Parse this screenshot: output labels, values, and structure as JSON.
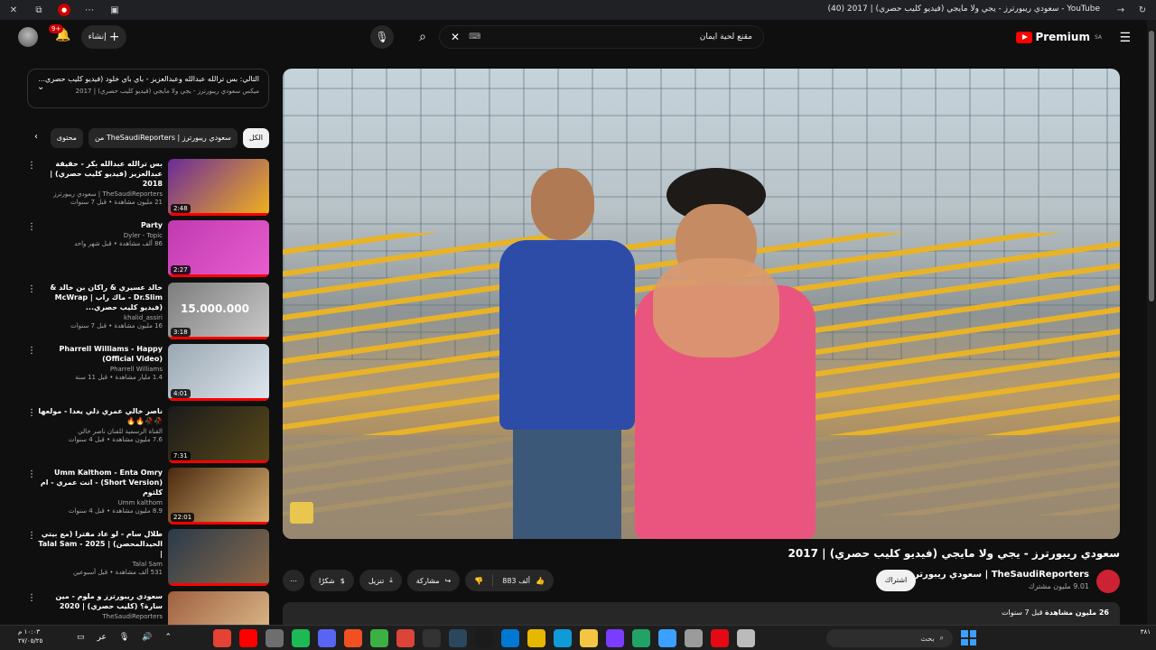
{
  "browser": {
    "title": "YouTube - سعودي ريبورترز - يجي ولا مايجي (فيديو كليب حصري) | 2017 (40)",
    "icons": [
      "close-icon",
      "extension-icon",
      "badge-icon",
      "more-icon",
      "screenshot-icon"
    ]
  },
  "header": {
    "create_label": "إنشاء",
    "notifications_badge": "9+",
    "search_value": "مقنع لحية ايمان",
    "keyboard_label": "⌨",
    "logo_text": "Premium",
    "region": "SA"
  },
  "queue_header": {
    "next_label": "التالي: بس ترالله عبدالله وعبدالعزيز - باي باي خلود (فيديو كليب حصري...",
    "mix_label": "ميكس سعودي ريبورترز - يجي ولا مايجي (فيديو كليب حصري) | 2017"
  },
  "chips": [
    {
      "label": "الكل",
      "active": true
    },
    {
      "label": "من TheSaudiReporters | سعودي ريبورترز",
      "active": false
    },
    {
      "label": "محتوى",
      "active": false
    }
  ],
  "queue": [
    {
      "title": "بس ترالله عبدالله بكر - حقيقة عبدالعزيز (فيديو كليب حصري) | 2018",
      "channel": "TheSaudiReporters | سعودي ريبورترز",
      "stats": "21 مليون مشاهدة • قبل 7 سنوات",
      "duration": "2:48",
      "thumb": "#6b2a9a",
      "thumb2": "#f2b21c"
    },
    {
      "title": "Party",
      "channel": "Dyler - Topic",
      "stats": "86 ألف مشاهدة • قبل شهر واحد",
      "duration": "2:27",
      "thumb": "#c03ab0",
      "thumb2": "#e85ed0"
    },
    {
      "title": "خالد عسيري & راكان بن خالد & Dr.Slim - ماك راب | McWrap (فيديو كليب حصري...",
      "channel": "khalid_assiri",
      "stats": "16 مليون مشاهدة • قبل 7 سنوات",
      "duration": "3:18",
      "thumb": "#7d7d7d",
      "thumb2": "#c9c9c9",
      "overlay": "15.000.000"
    },
    {
      "title": "Pharrell Williams - Happy (Official Video)",
      "channel": "Pharrell Williams",
      "stats": "1.4 مليار مشاهدة • قبل 11 سنة",
      "duration": "4:01",
      "thumb": "#9aa7b2",
      "thumb2": "#dfe7ee"
    },
    {
      "title": "ناصر خالي عمري ذلي يعدا - مولعها 🥀🥀🔥🔥",
      "channel": "القناة الرسمية للفنان ناصر خالي",
      "stats": "7.6 مليون مشاهدة • قبل 4 سنوات",
      "duration": "7:31",
      "thumb": "#1a1a1a",
      "thumb2": "#5a4a1a"
    },
    {
      "title": "Umm Kalthom - Enta Omry (Short Version) - انت عمري - ام كلثوم",
      "channel": "Umm kalthom",
      "stats": "8.9 مليون مشاهدة • قبل 4 سنوات",
      "duration": "22:01",
      "thumb": "#4a2a10",
      "thumb2": "#d8b070"
    },
    {
      "title": "طلال سام - لو عاد مفترا (مع بيتي الحيدالمحصن) | Talal Sam - 2025 |",
      "channel": "Talal Sam",
      "stats": "531 ألف مشاهدة • قبل أسبوعين",
      "duration": "",
      "thumb": "#2a3a4a",
      "thumb2": "#8a6a4a"
    },
    {
      "title": "سعودي ريبورترز و ملوم - مين سارة؟ (كليب حصري) | 2020",
      "channel": "TheSaudiReporters",
      "stats": "",
      "duration": "",
      "thumb": "#a06040",
      "thumb2": "#e0c090"
    }
  ],
  "video": {
    "title": "سعودي ريبورترز - يجي ولا مايجي (فيديو كليب حصري) | 2017",
    "channel": "TheSaudiReporters | سعودي ريبورترز",
    "subscribers": "9.01 مليون مشترك",
    "subscribe_label": "اشتراك",
    "likes": "883 ألف",
    "share_label": "مشاركة",
    "download_label": "تنزيل",
    "thanks_label": "شكرًا",
    "views_label": "26 مليون مشاهدة",
    "age_label": "قبل 7 سنوات"
  },
  "taskbar": {
    "time": "١٠:٠٣ م",
    "date": "٢٧/٠٥/٢٥",
    "search_placeholder": "بحث",
    "lang": "عر",
    "lang_num": "٣٨١",
    "apps": [
      "#e34234",
      "#ff0000",
      "#6e6e6e",
      "#1db954",
      "#5865f2",
      "#f25022",
      "#3cb043",
      "#db4437",
      "#333333",
      "#2a475e",
      "#1b1b1b",
      "#0078d4",
      "#e6b800",
      "#0f9bd7",
      "#f4c542",
      "#7a3cff",
      "#21a366",
      "#3ba0ff",
      "#9b9b9b",
      "#e50914",
      "#bbbbbb"
    ]
  }
}
